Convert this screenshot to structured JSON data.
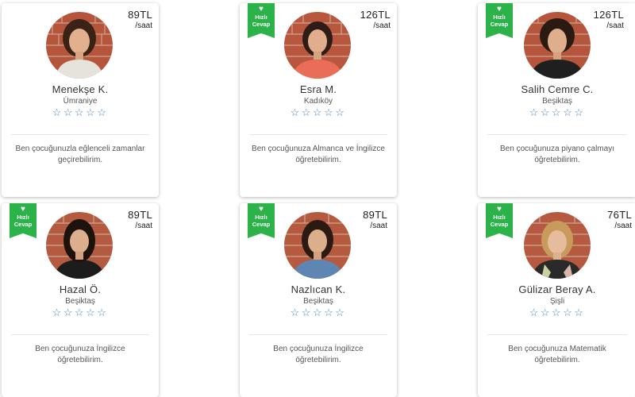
{
  "badge": {
    "label": "Hızlı Cevap",
    "icon": "heart-icon",
    "color": "#2bb34a"
  },
  "star_color": "#4f86b8",
  "cards": [
    {
      "price": "89TL",
      "unit": "/saat",
      "name": "Menekşe K.",
      "location": "Ümraniye",
      "stars": "☆☆☆☆☆",
      "fast_reply": false,
      "description": "Ben çocuğunuzla eğlenceli zamanlar geçirebilirim."
    },
    {
      "price": "126TL",
      "unit": "/saat",
      "name": "Esra M.",
      "location": "Kadıköy",
      "stars": "☆☆☆☆☆",
      "fast_reply": true,
      "description": "Ben çocuğunuza Almanca ve İngilizce öğretebilirim."
    },
    {
      "price": "126TL",
      "unit": "/saat",
      "name": "Salih Cemre C.",
      "location": "Beşiktaş",
      "stars": "☆☆☆☆☆",
      "fast_reply": true,
      "description": "Ben çocuğunuza piyano çalmayı öğretebilirim."
    },
    {
      "price": "89TL",
      "unit": "/saat",
      "name": "Hazal Ö.",
      "location": "Beşiktaş",
      "stars": "☆☆☆☆☆",
      "fast_reply": true,
      "description": "Ben çocuğunuza İngilizce öğretebilirim."
    },
    {
      "price": "89TL",
      "unit": "/saat",
      "name": "Nazlıcan K.",
      "location": "Beşiktaş",
      "stars": "☆☆☆☆☆",
      "fast_reply": true,
      "description": "Ben çocuğunuza İngilizce öğretebilirim."
    },
    {
      "price": "76TL",
      "unit": "/saat",
      "name": "Gülizar Beray A.",
      "location": "Şişli",
      "stars": "☆☆☆☆☆",
      "fast_reply": true,
      "description": "Ben çocuğunuza Matematik öğretebilirim."
    }
  ]
}
